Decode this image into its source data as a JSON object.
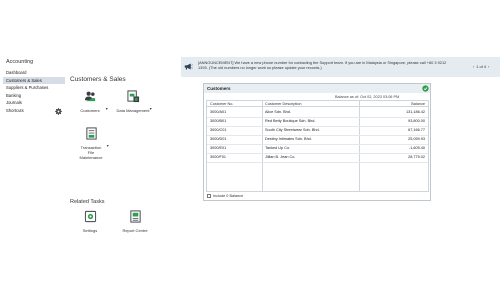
{
  "sidebar": {
    "title": "Accounting",
    "items": [
      {
        "label": "Dashboard"
      },
      {
        "label": "Customers & Sales"
      },
      {
        "label": "Suppliers & Purchases"
      },
      {
        "label": "Banking"
      },
      {
        "label": "Journals"
      },
      {
        "label": "Shortcuts"
      }
    ]
  },
  "banner": {
    "icon": "megaphone-icon",
    "text": "[ANNOUNCEMENT] We have a new phone number for contacting the Support team. If you are in Malaysia or Singapore, please call +60 3 9212 1393. (The old numbers no longer work so please update your records.)",
    "prev": "‹",
    "pager": "1 of 4",
    "next": "›"
  },
  "main": {
    "title": "Customers & Sales",
    "tiles": [
      {
        "label": "Customers",
        "icon": "customers-icon"
      },
      {
        "label": "Data Management",
        "icon": "data-management-icon"
      },
      {
        "label": "Transaction File Maintenance",
        "icon": "transaction-file-icon"
      }
    ],
    "related_title": "Related Tasks",
    "related": [
      {
        "label": "Settings",
        "icon": "settings-icon"
      },
      {
        "label": "Report Centre",
        "icon": "report-centre-icon"
      }
    ]
  },
  "panel": {
    "title": "Customers",
    "balance_as_of": "Balance as of: Oct 02, 2023 03:06 PM",
    "columns": [
      "Customer No.",
      "Customer Description",
      "Balance"
    ],
    "rows": [
      {
        "no": "3000/A01",
        "desc": "Alice Sdn. Bhd.",
        "balance": "131,186.42"
      },
      {
        "no": "3000/B01",
        "desc": "Red Betty Boutique Sdn. Bhd.",
        "balance": "93,800.00"
      },
      {
        "no": "3000/C01",
        "desc": "South City Streetwear Sdn. Bhd.",
        "balance": "67,166.77"
      },
      {
        "no": "3000/D01",
        "desc": "Destiny Intimates Sdn. Bhd.",
        "balance": "25,059.93"
      },
      {
        "no": "3000/E01",
        "desc": "Tanked Up Co.",
        "balance": "-1,605.40"
      },
      {
        "no": "3000/F01",
        "desc": "Jillian B. Jean Co.",
        "balance": "28,775.02"
      }
    ],
    "footer_label": "Include 0 Balance"
  },
  "colors": {
    "banner_bg": "#e4ecf2",
    "active_item_bg": "#d6dde6",
    "accent_green": "#2e9e4f"
  }
}
